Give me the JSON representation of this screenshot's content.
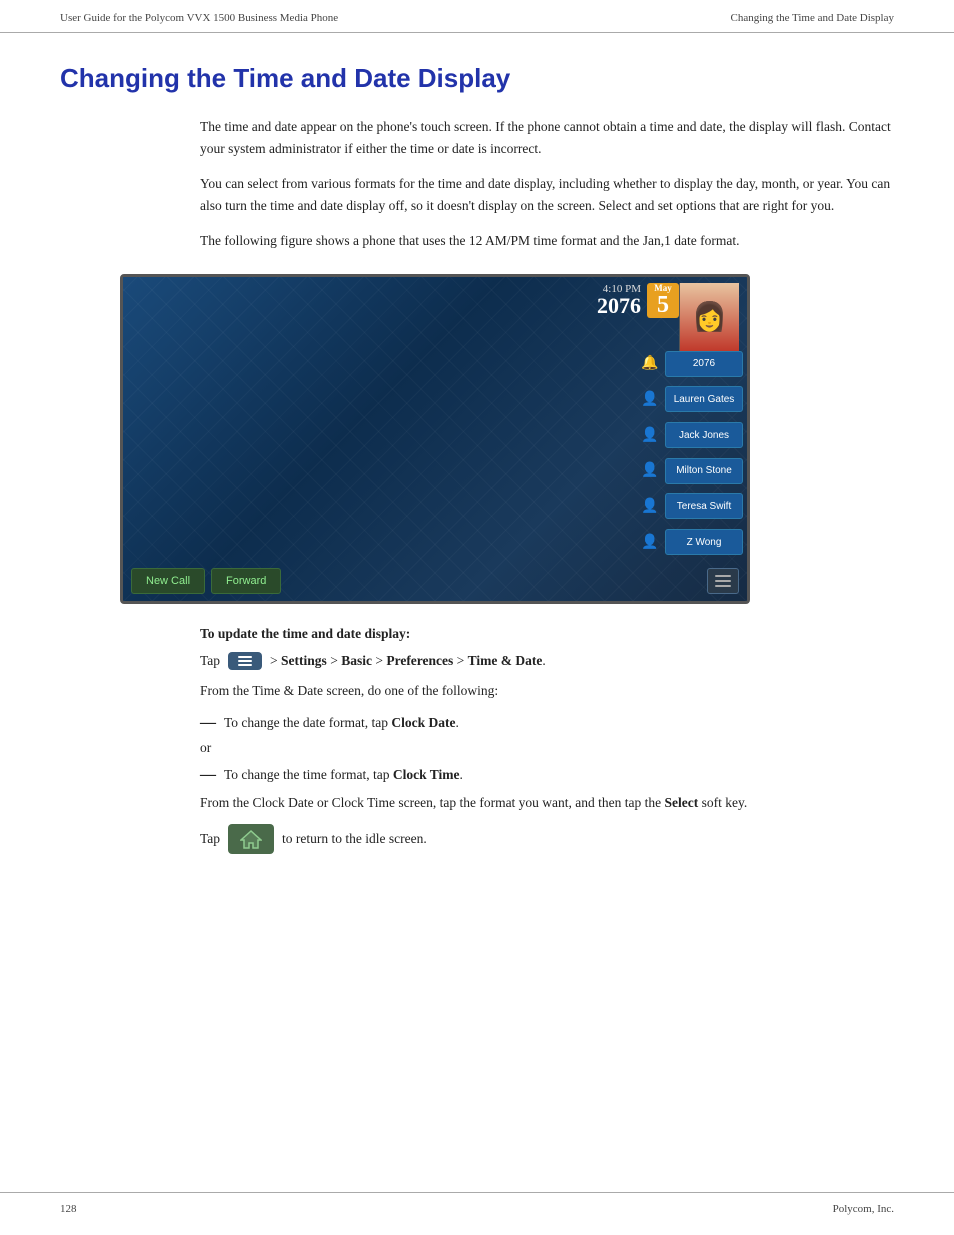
{
  "header": {
    "left": "User Guide for the Polycom VVX 1500 Business Media Phone",
    "right": "Changing the Time and Date Display"
  },
  "title": "Changing the Time and Date Display",
  "paragraphs": {
    "p1": "The time and date appear on the phone's touch screen. If the phone cannot obtain a time and date, the display will flash. Contact your system administrator if either the time or date is incorrect.",
    "p2": "You can select from various formats for the time and date display, including whether to display the day, month, or year. You can also turn the time and date display off, so it doesn't display on the screen. Select and set options that are right for you.",
    "p3": "The following figure shows a phone that uses the 12 AM/PM time format and the Jan,1 date format."
  },
  "phone": {
    "time": "4:10 PM",
    "year": "2076",
    "month": "May",
    "day": "5",
    "contacts": [
      {
        "label": "2076",
        "active": false
      },
      {
        "label": "Lauren Gates",
        "active": false
      },
      {
        "label": "Jack Jones",
        "active": false
      },
      {
        "label": "Milton Stone",
        "active": false
      },
      {
        "label": "Teresa Swift",
        "active": false
      },
      {
        "label": "Z Wong",
        "active": false
      }
    ],
    "softkeys": {
      "newCall": "New Call",
      "forward": "Forward"
    }
  },
  "instructions": {
    "heading": "To update the time and date display:",
    "tap_prefix": "Tap",
    "tap_suffix": "> Settings > Basic > Preferences > Time & Date.",
    "from_line": "From the Time & Date screen, do one of the following:",
    "bullet1_pre": "To change the date format, tap ",
    "bullet1_bold": "Clock Date",
    "bullet1_post": ".",
    "or": "or",
    "bullet2_pre": "To change the time format, tap ",
    "bullet2_bold": "Clock Time",
    "bullet2_post": ".",
    "from_clock_pre": "From the Clock Date or Clock Time screen, tap the format you want, and then tap the ",
    "from_clock_bold": "Select",
    "from_clock_post": " soft key.",
    "tap2_prefix": "Tap",
    "tap2_suffix": "to return to the idle screen."
  },
  "footer": {
    "page": "128",
    "company": "Polycom, Inc."
  }
}
